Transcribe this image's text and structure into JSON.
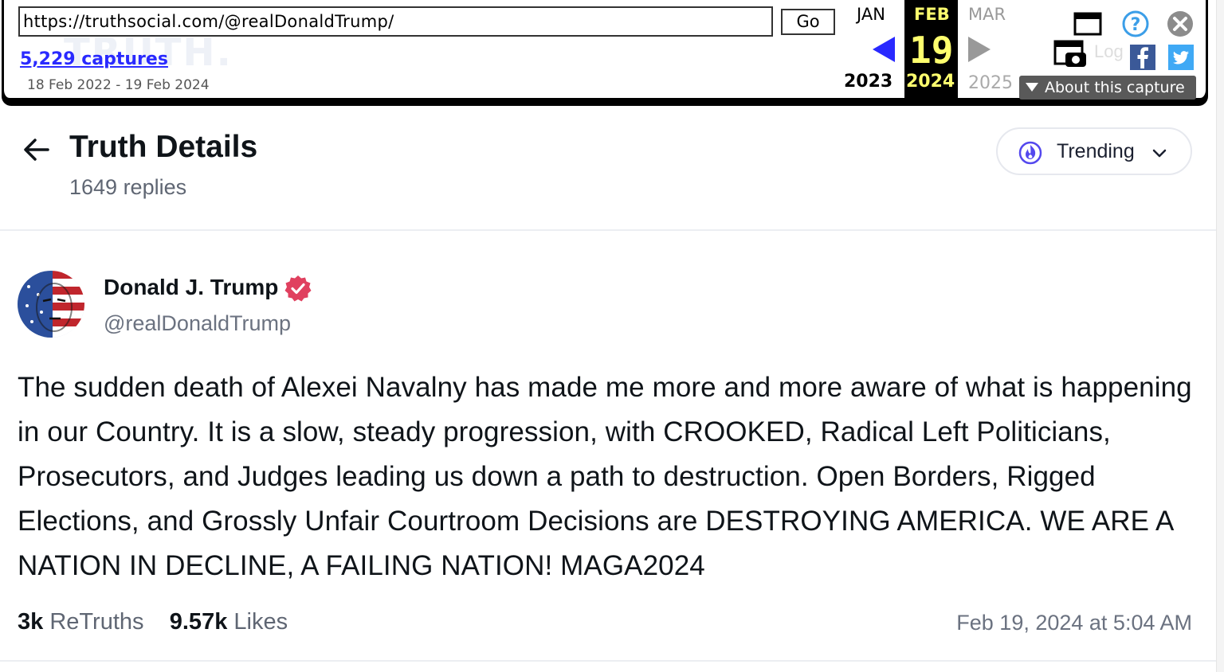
{
  "wayback": {
    "url": "https://truthsocial.com/@realDonaldTrump/",
    "go_label": "Go",
    "watermark": "TRUTH.",
    "captures": "5,229 captures",
    "date_range": "18 Feb 2022 - 19 Feb 2024",
    "prev_month": "JAN",
    "current_month": "FEB",
    "next_month": "MAR",
    "current_day": "19",
    "prev_year": "2023",
    "current_year": "2024",
    "next_year": "2025",
    "about_label": "About this capture",
    "log_ghost": "Log"
  },
  "header": {
    "title": "Truth Details",
    "replies": "1649 replies",
    "sort_label": "Trending"
  },
  "post": {
    "author_name": "Donald J. Trump",
    "handle": "@realDonaldTrump",
    "text": "The sudden death of Alexei Navalny has made me more and more aware of what is happening in our Country. It is a slow, steady progression, with CROOKED, Radical Left Politicians, Prosecutors, and Judges leading us down a path to destruction. Open Borders, Rigged Elections, and Grossly Unfair Courtroom Decisions are DESTROYING AMERICA. WE ARE A NATION IN DECLINE, A FAILING NATION! MAGA2024",
    "retruths_count": "3k",
    "retruths_label": "ReTruths",
    "likes_count": "9.57k",
    "likes_label": "Likes",
    "timestamp": "Feb 19, 2024 at 5:04 AM"
  },
  "colors": {
    "accent": "#5448ee",
    "verified": "#e0405f",
    "wayback_highlight": "#ffff6e",
    "wayback_link": "#2a2aff"
  },
  "icons": [
    "back-arrow-icon",
    "fire-icon",
    "chevron-down-icon",
    "verified-badge-icon",
    "calendar-icon",
    "screenshot-icon",
    "help-icon",
    "close-icon",
    "facebook-icon",
    "twitter-icon"
  ]
}
